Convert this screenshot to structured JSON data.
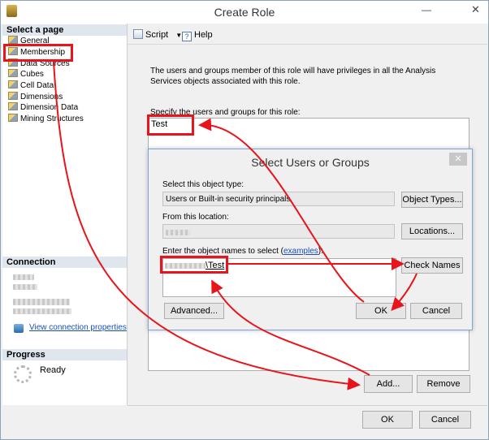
{
  "window": {
    "title": "Create Role"
  },
  "sidebar": {
    "select_page_header": "Select a page",
    "pages": [
      {
        "label": "General"
      },
      {
        "label": "Membership"
      },
      {
        "label": "Data Sources"
      },
      {
        "label": "Cubes"
      },
      {
        "label": "Cell Data"
      },
      {
        "label": "Dimensions"
      },
      {
        "label": "Dimension Data"
      },
      {
        "label": "Mining Structures"
      }
    ],
    "connection_header": "Connection",
    "view_connection_properties": "View connection properties",
    "progress_header": "Progress",
    "progress_status": "Ready"
  },
  "toolbar": {
    "script_label": "Script",
    "help_label": "Help"
  },
  "membership": {
    "description": "The users and groups member of this role will have privileges in all the Analysis Services objects associated with this role.",
    "specify_label": "Specify the users and groups for this role:",
    "members": [
      "Test"
    ],
    "add_button": "Add...",
    "remove_button": "Remove"
  },
  "dialog": {
    "title": "Select Users or Groups",
    "object_type_label": "Select this object type:",
    "object_type_value": "Users or Built-in security principals",
    "object_types_button": "Object Types...",
    "location_label": "From this location:",
    "locations_button": "Locations...",
    "enter_names_label": "Enter the object names to select",
    "examples_link": "examples",
    "object_name_suffix": "\\Test",
    "check_names_button": "Check Names",
    "advanced_button": "Advanced...",
    "ok_button": "OK",
    "cancel_button": "Cancel"
  },
  "footer": {
    "ok_button": "OK",
    "cancel_button": "Cancel"
  },
  "colors": {
    "annotation_red": "#e8141c",
    "link_blue": "#1a4fb5"
  }
}
